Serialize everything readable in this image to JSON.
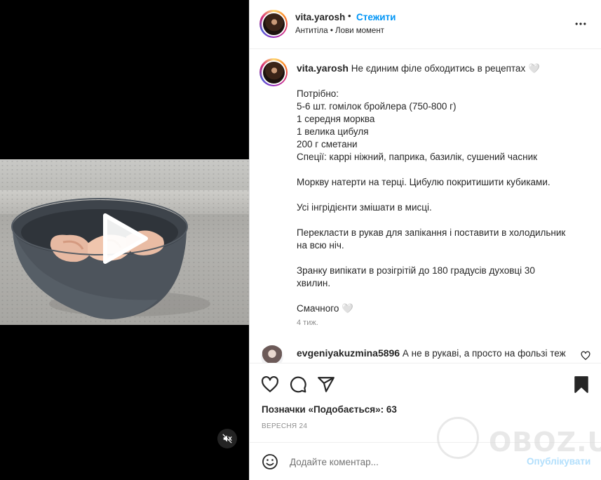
{
  "header": {
    "username": "vita.yarosh",
    "separator": "•",
    "follow_label": "Стежити",
    "subtitle": "Антитіла • Лови момент"
  },
  "caption": {
    "username": "vita.yarosh",
    "lines": [
      "Не єдиним філе обходитись в рецептах 🤍",
      "",
      "Потрібно:",
      "5-6 шт. гомілок бройлера (750-800 г)",
      "1 середня морква",
      "1 велика цибуля",
      "200 г сметани",
      "Спеції: каррі ніжний, паприка, базилік, сушений часник",
      "",
      "Моркву натерти на терці. Цибулю покритишити кубиками.",
      "",
      "Усі інгрідієнти змішати в мисці.",
      "",
      "Перекласти в рукав для запікання і поставити в холодильник",
      "на всю ніч.",
      "",
      "Зранку випікати в розігрітій до 180 градусів духовці 30",
      "хвилин.",
      "",
      "Смачного 🤍"
    ],
    "time_ago": "4 тиж."
  },
  "comment": {
    "username": "evgeniyakuzmina5896",
    "text": "А не в рукаві, а просто на фользі теж"
  },
  "actions": {
    "likes_label": "Позначки «Подобається»:",
    "likes_count": "63",
    "date": "ВЕРЕСНЯ 24"
  },
  "add_comment": {
    "placeholder": "Додайте коментар...",
    "publish_label": "Опублікувати"
  },
  "watermark": {
    "text": "OBOZ.UA"
  },
  "icons": {
    "play": "play-icon",
    "mute": "muted-speaker-icon",
    "more": "more-horizontal-icon",
    "like": "heart-icon",
    "comment": "comment-bubble-icon",
    "share": "paper-plane-icon",
    "save": "bookmark-icon",
    "emoji": "smiley-icon"
  },
  "colors": {
    "accent": "#0095f6",
    "publish_disabled": "#b2dffc",
    "text": "#262626",
    "muted": "#8e8e8e"
  }
}
